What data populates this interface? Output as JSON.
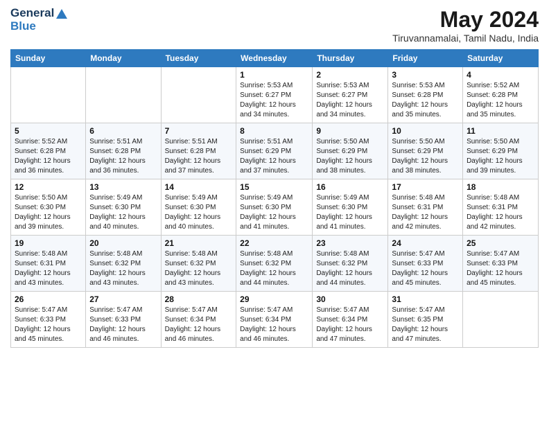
{
  "logo": {
    "general": "General",
    "blue": "Blue"
  },
  "title": {
    "month_year": "May 2024",
    "location": "Tiruvannamalai, Tamil Nadu, India"
  },
  "days_of_week": [
    "Sunday",
    "Monday",
    "Tuesday",
    "Wednesday",
    "Thursday",
    "Friday",
    "Saturday"
  ],
  "weeks": [
    [
      {
        "day": "",
        "info": ""
      },
      {
        "day": "",
        "info": ""
      },
      {
        "day": "",
        "info": ""
      },
      {
        "day": "1",
        "info": "Sunrise: 5:53 AM\nSunset: 6:27 PM\nDaylight: 12 hours\nand 34 minutes."
      },
      {
        "day": "2",
        "info": "Sunrise: 5:53 AM\nSunset: 6:27 PM\nDaylight: 12 hours\nand 34 minutes."
      },
      {
        "day": "3",
        "info": "Sunrise: 5:53 AM\nSunset: 6:28 PM\nDaylight: 12 hours\nand 35 minutes."
      },
      {
        "day": "4",
        "info": "Sunrise: 5:52 AM\nSunset: 6:28 PM\nDaylight: 12 hours\nand 35 minutes."
      }
    ],
    [
      {
        "day": "5",
        "info": "Sunrise: 5:52 AM\nSunset: 6:28 PM\nDaylight: 12 hours\nand 36 minutes."
      },
      {
        "day": "6",
        "info": "Sunrise: 5:51 AM\nSunset: 6:28 PM\nDaylight: 12 hours\nand 36 minutes."
      },
      {
        "day": "7",
        "info": "Sunrise: 5:51 AM\nSunset: 6:28 PM\nDaylight: 12 hours\nand 37 minutes."
      },
      {
        "day": "8",
        "info": "Sunrise: 5:51 AM\nSunset: 6:29 PM\nDaylight: 12 hours\nand 37 minutes."
      },
      {
        "day": "9",
        "info": "Sunrise: 5:50 AM\nSunset: 6:29 PM\nDaylight: 12 hours\nand 38 minutes."
      },
      {
        "day": "10",
        "info": "Sunrise: 5:50 AM\nSunset: 6:29 PM\nDaylight: 12 hours\nand 38 minutes."
      },
      {
        "day": "11",
        "info": "Sunrise: 5:50 AM\nSunset: 6:29 PM\nDaylight: 12 hours\nand 39 minutes."
      }
    ],
    [
      {
        "day": "12",
        "info": "Sunrise: 5:50 AM\nSunset: 6:30 PM\nDaylight: 12 hours\nand 39 minutes."
      },
      {
        "day": "13",
        "info": "Sunrise: 5:49 AM\nSunset: 6:30 PM\nDaylight: 12 hours\nand 40 minutes."
      },
      {
        "day": "14",
        "info": "Sunrise: 5:49 AM\nSunset: 6:30 PM\nDaylight: 12 hours\nand 40 minutes."
      },
      {
        "day": "15",
        "info": "Sunrise: 5:49 AM\nSunset: 6:30 PM\nDaylight: 12 hours\nand 41 minutes."
      },
      {
        "day": "16",
        "info": "Sunrise: 5:49 AM\nSunset: 6:30 PM\nDaylight: 12 hours\nand 41 minutes."
      },
      {
        "day": "17",
        "info": "Sunrise: 5:48 AM\nSunset: 6:31 PM\nDaylight: 12 hours\nand 42 minutes."
      },
      {
        "day": "18",
        "info": "Sunrise: 5:48 AM\nSunset: 6:31 PM\nDaylight: 12 hours\nand 42 minutes."
      }
    ],
    [
      {
        "day": "19",
        "info": "Sunrise: 5:48 AM\nSunset: 6:31 PM\nDaylight: 12 hours\nand 43 minutes."
      },
      {
        "day": "20",
        "info": "Sunrise: 5:48 AM\nSunset: 6:32 PM\nDaylight: 12 hours\nand 43 minutes."
      },
      {
        "day": "21",
        "info": "Sunrise: 5:48 AM\nSunset: 6:32 PM\nDaylight: 12 hours\nand 43 minutes."
      },
      {
        "day": "22",
        "info": "Sunrise: 5:48 AM\nSunset: 6:32 PM\nDaylight: 12 hours\nand 44 minutes."
      },
      {
        "day": "23",
        "info": "Sunrise: 5:48 AM\nSunset: 6:32 PM\nDaylight: 12 hours\nand 44 minutes."
      },
      {
        "day": "24",
        "info": "Sunrise: 5:47 AM\nSunset: 6:33 PM\nDaylight: 12 hours\nand 45 minutes."
      },
      {
        "day": "25",
        "info": "Sunrise: 5:47 AM\nSunset: 6:33 PM\nDaylight: 12 hours\nand 45 minutes."
      }
    ],
    [
      {
        "day": "26",
        "info": "Sunrise: 5:47 AM\nSunset: 6:33 PM\nDaylight: 12 hours\nand 45 minutes."
      },
      {
        "day": "27",
        "info": "Sunrise: 5:47 AM\nSunset: 6:33 PM\nDaylight: 12 hours\nand 46 minutes."
      },
      {
        "day": "28",
        "info": "Sunrise: 5:47 AM\nSunset: 6:34 PM\nDaylight: 12 hours\nand 46 minutes."
      },
      {
        "day": "29",
        "info": "Sunrise: 5:47 AM\nSunset: 6:34 PM\nDaylight: 12 hours\nand 46 minutes."
      },
      {
        "day": "30",
        "info": "Sunrise: 5:47 AM\nSunset: 6:34 PM\nDaylight: 12 hours\nand 47 minutes."
      },
      {
        "day": "31",
        "info": "Sunrise: 5:47 AM\nSunset: 6:35 PM\nDaylight: 12 hours\nand 47 minutes."
      },
      {
        "day": "",
        "info": ""
      }
    ]
  ]
}
